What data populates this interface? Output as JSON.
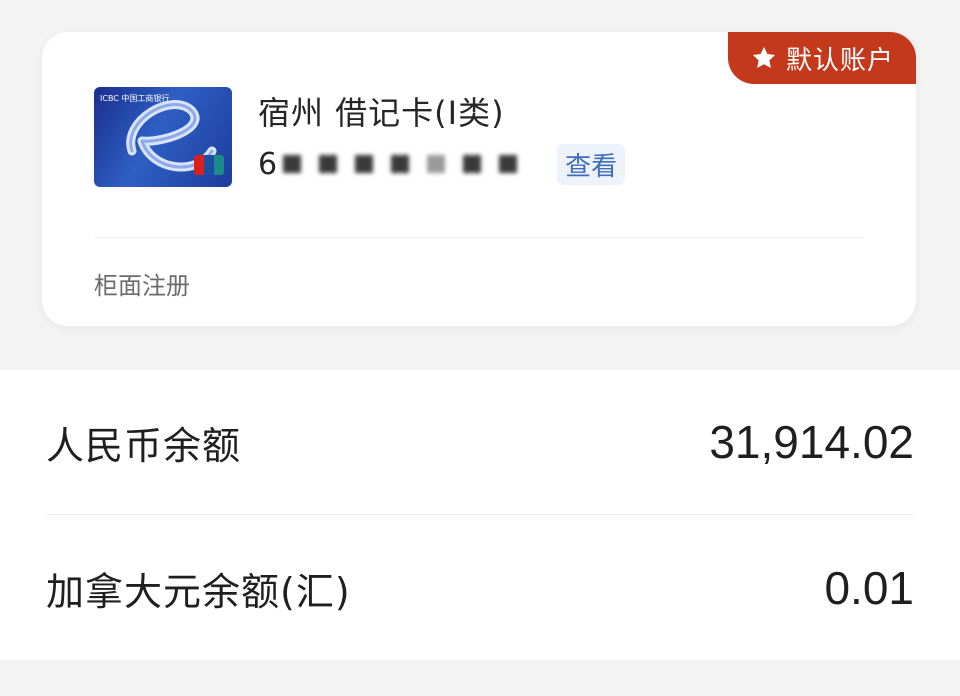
{
  "account_card": {
    "default_badge": "默认账户",
    "bank_mark": "ICBC 中国工商银行",
    "account_name": "宿州 借记卡(Ⅰ类)",
    "account_number_prefix": "6",
    "view_label": "查看",
    "register_note": "柜面注册"
  },
  "balances": [
    {
      "label": "人民币余额",
      "value": "31,914.02"
    },
    {
      "label": "加拿大元余额(汇)",
      "value": "0.01"
    }
  ],
  "colors": {
    "badge": "#c4381c",
    "link": "#3d6dbb"
  }
}
